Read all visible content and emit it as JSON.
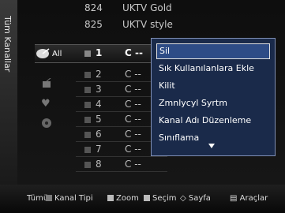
{
  "sidebar": {
    "title": "Tüm Kanallar"
  },
  "top_channels": [
    {
      "num": "824",
      "name": "UKTV Gold"
    },
    {
      "num": "825",
      "name": "UKTV style"
    }
  ],
  "filter_icons": [
    {
      "label": "All",
      "icon": "satellite-dish-icon"
    },
    {
      "icon": "tv-antenna-icon"
    },
    {
      "icon": "heart-icon"
    },
    {
      "icon": "lock-icon"
    }
  ],
  "channels": [
    {
      "num": "1",
      "name": "C --"
    },
    {
      "num": "2",
      "name": "C --"
    },
    {
      "num": "3",
      "name": "C --"
    },
    {
      "num": "4",
      "name": "C --"
    },
    {
      "num": "5",
      "name": "C --"
    },
    {
      "num": "6",
      "name": "C --"
    },
    {
      "num": "7",
      "name": "C --"
    },
    {
      "num": "8",
      "name": "C --"
    }
  ],
  "menu": {
    "items": [
      "Sil",
      "Sık Kullanılanlara Ekle",
      "Kilit",
      "Zmnlycyl Syrtm",
      "Kanal Adı Düzenleme",
      "Sınıflama"
    ]
  },
  "bottom": {
    "all": "Tümü",
    "channel_type": "Kanal Tipi",
    "zoom": "Zoom",
    "select": "Seçim",
    "page": "Sayfa",
    "tools": "Araçlar"
  },
  "colors": {
    "menu_bg": "#1a2a4a",
    "menu_active": "#2e4c86"
  }
}
